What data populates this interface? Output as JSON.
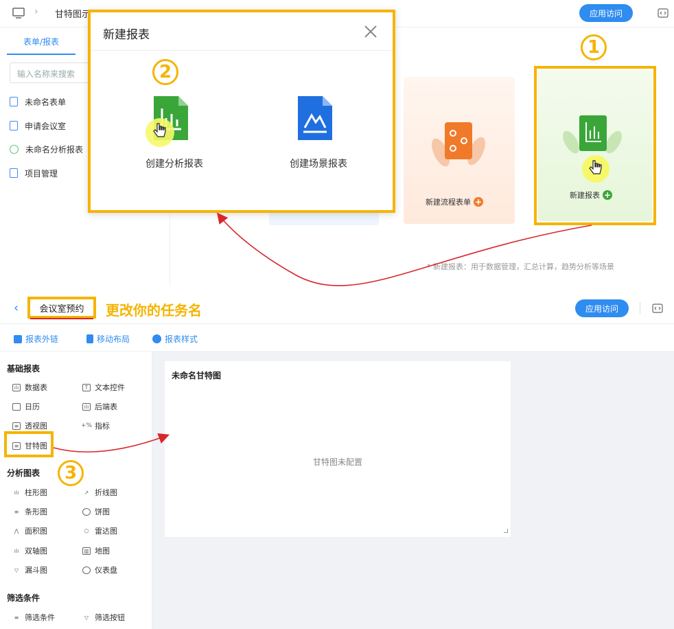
{
  "top": {
    "breadcrumb_title": "甘特图示例",
    "access_button": "应用访问",
    "tab_label": "表单/报表",
    "search_placeholder": "输入名称来搜索",
    "nav_items": [
      "未命名表单",
      "申请会议室",
      "未命名分析报表",
      "项目管理"
    ],
    "flow_card_label": "新建流程表单",
    "report_card_label": "新建报表",
    "hint_text": "* 新建报表：用于数据管理，汇总计算，趋势分析等场景"
  },
  "modal": {
    "title": "新建报表",
    "option_analysis": "创建分析报表",
    "option_scene": "创建场景报表"
  },
  "annotations": {
    "step1": "1",
    "step2": "2",
    "step3": "3",
    "rename_tip": "更改你的任务名"
  },
  "bottom": {
    "app_name": "会议室预约",
    "access_button": "应用访问",
    "toolbar": [
      "报表外链",
      "移动布局",
      "报表样式"
    ],
    "sections": {
      "basic": "基础报表",
      "analysis": "分析图表",
      "filter": "筛选条件"
    },
    "basic_items": [
      [
        "数据表",
        "文本控件"
      ],
      [
        "日历",
        "后端表"
      ],
      [
        "透视图",
        "指标"
      ],
      [
        "甘特图",
        ""
      ]
    ],
    "analysis_items": [
      [
        "柱形图",
        "折线图"
      ],
      [
        "条形图",
        "饼图"
      ],
      [
        "面积图",
        "雷达图"
      ],
      [
        "双轴图",
        "地图"
      ],
      [
        "漏斗图",
        "仪表盘"
      ]
    ],
    "filter_items": [
      "筛选条件",
      "筛选按钮"
    ],
    "gantt_title": "未命名甘特图",
    "gantt_empty": "甘特图未配置"
  },
  "colors": {
    "accent": "#2f8cf0",
    "highlight": "#f5b400",
    "arrow": "#d9262b"
  }
}
